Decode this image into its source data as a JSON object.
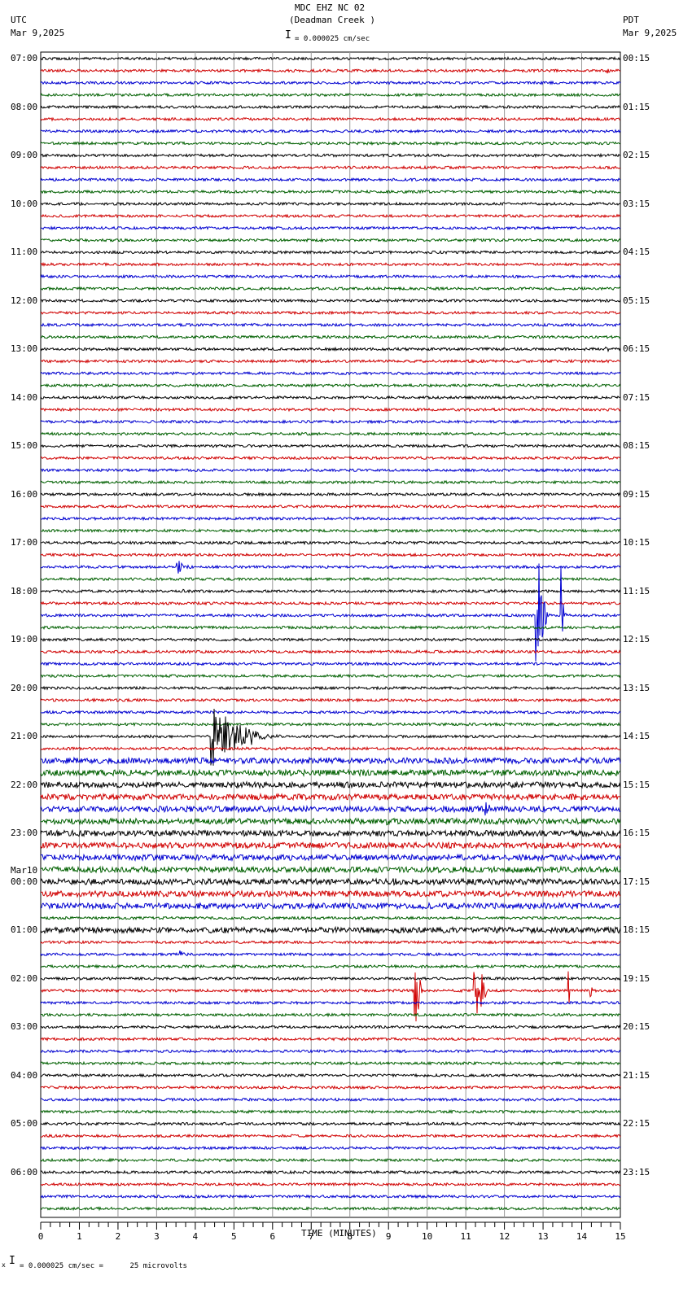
{
  "header": {
    "title": "MDC EHZ NC 02",
    "subtitle": "(Deadman Creek )",
    "left_tz": "UTC",
    "left_date": "Mar 9,2025",
    "right_tz": "PDT",
    "right_date": "Mar 9,2025",
    "scale": "= 0.000025 cm/sec"
  },
  "footer": {
    "scale": "= 0.000025 cm/sec =      25 microvolts",
    "marker": "x"
  },
  "chart_data": {
    "type": "line",
    "title": "MDC EHZ NC 02 (Deadman Creek )",
    "xlabel": "TIME (MINUTES)",
    "xlim": [
      0,
      15
    ],
    "xticks": [
      "0",
      "1",
      "2",
      "3",
      "4",
      "5",
      "6",
      "7",
      "8",
      "9",
      "10",
      "11",
      "12",
      "13",
      "14",
      "15"
    ],
    "rows_per_hour": 4,
    "row_count": 96,
    "trace_colors": [
      "#000000",
      "#d00000",
      "#0000d0",
      "#006000"
    ],
    "utc_labels": [
      "07:00",
      "08:00",
      "09:00",
      "10:00",
      "11:00",
      "12:00",
      "13:00",
      "14:00",
      "15:00",
      "16:00",
      "17:00",
      "18:00",
      "19:00",
      "20:00",
      "21:00",
      "22:00",
      "23:00",
      "00:00",
      "01:00",
      "02:00",
      "03:00",
      "04:00",
      "05:00",
      "06:00"
    ],
    "date_change_label": "Mar10",
    "pdt_labels": [
      "00:15",
      "01:15",
      "02:15",
      "03:15",
      "04:15",
      "05:15",
      "06:15",
      "07:15",
      "08:15",
      "09:15",
      "10:15",
      "11:15",
      "12:15",
      "13:15",
      "14:15",
      "15:15",
      "16:15",
      "17:15",
      "18:15",
      "19:15",
      "20:15",
      "21:15",
      "22:15",
      "23:15"
    ],
    "events": [
      {
        "row": 42,
        "minute": 3.5,
        "duration": 0.5,
        "amplitude": 14
      },
      {
        "row": 44,
        "minute": 3.65,
        "duration": 0.2,
        "amplitude": 6
      },
      {
        "row": 56,
        "minute": 4.4,
        "duration": 2.0,
        "amplitude": 40
      },
      {
        "row": 46,
        "minute": 12.8,
        "duration": 0.4,
        "amplitude": 110
      },
      {
        "row": 46,
        "minute": 13.45,
        "duration": 0.2,
        "amplitude": 70
      },
      {
        "row": 62,
        "minute": 11.5,
        "duration": 0.5,
        "amplitude": 8
      },
      {
        "row": 63,
        "minute": 8.9,
        "duration": 0.3,
        "amplitude": 7
      },
      {
        "row": 68,
        "minute": 9.1,
        "duration": 0.2,
        "amplitude": 8
      },
      {
        "row": 77,
        "minute": 9.65,
        "duration": 0.35,
        "amplitude": 60
      },
      {
        "row": 77,
        "minute": 11.2,
        "duration": 0.45,
        "amplitude": 85
      },
      {
        "row": 77,
        "minute": 13.65,
        "duration": 0.15,
        "amplitude": 25
      },
      {
        "row": 77,
        "minute": 14.2,
        "duration": 0.15,
        "amplitude": 15
      },
      {
        "row": 1,
        "minute": 14.6,
        "duration": 0.2,
        "amplitude": 4
      },
      {
        "row": 24,
        "minute": 14.6,
        "duration": 0.2,
        "amplitude": 4
      },
      {
        "row": 74,
        "minute": 3.6,
        "duration": 0.2,
        "amplitude": 6
      }
    ],
    "noisy_rows": [
      58,
      59,
      60,
      61,
      62,
      63,
      64,
      65,
      66,
      67,
      68,
      69,
      70,
      72
    ]
  }
}
